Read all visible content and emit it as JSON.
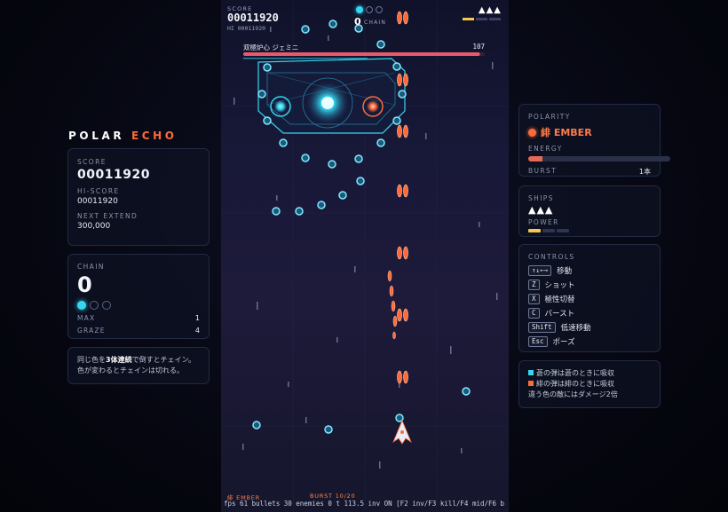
{
  "title": {
    "part1": "POLAR",
    "part2": "ECHO"
  },
  "left": {
    "score_label": "SCORE",
    "score": "00011920",
    "hiscore_label": "HI-SCORE",
    "hiscore": "00011920",
    "extend_label": "NEXT EXTEND",
    "extend": "300,000",
    "chain_label": "CHAIN",
    "chain": "0",
    "chain_dots": [
      true,
      false,
      false
    ],
    "max_label": "MAX",
    "max": "1",
    "graze_label": "GRAZE",
    "graze": "4",
    "hint_1a": "同じ色を",
    "hint_1b": "3体連続",
    "hint_1c": "で倒すとチェイン。",
    "hint_2": "色が変わるとチェインは切れる。"
  },
  "right": {
    "polarity_label": "POLARITY",
    "polarity_value": "緋 EMBER",
    "energy_label": "ENERGY",
    "energy_fraction": 0.1,
    "burst_label": "BURST",
    "burst_value": "1本",
    "ships_label": "SHIPS",
    "ships": "▲▲▲",
    "power_label": "POWER",
    "power_level": 1,
    "power_max": 3,
    "controls_label": "CONTROLS",
    "controls": [
      {
        "key": "↑↓←→",
        "action": "移動"
      },
      {
        "key": "Z",
        "action": "ショット"
      },
      {
        "key": "X",
        "action": "極性切替"
      },
      {
        "key": "C",
        "action": "バースト"
      },
      {
        "key": "Shift",
        "action": "低速移動"
      },
      {
        "key": "Esc",
        "action": "ポーズ"
      }
    ],
    "legend_1": "蒼の弾は蒼のときに吸収",
    "legend_2": "緋の弾は緋のときに吸収",
    "legend_3": "違う色の敵にはダメージ2倍",
    "color_azure": "#35d6f0",
    "color_ember": "#ff6a3a"
  },
  "hud": {
    "score_label": "SCORE",
    "score": "00011920",
    "hi": "HI 00011920",
    "chain": "0",
    "chain_label": "CHAIN",
    "ships": "▲▲▲",
    "boss_name": "双極炉心 ジェミニ",
    "boss_hp": "107",
    "boss_hp_fraction": 0.98,
    "polarity": "緋 EMBER",
    "burst": "BURST 10/20",
    "debug": "fps 61  bullets 30  enemies 0  t 113.5  inv ON  [F2 inv/F3 kill/F4 mid/F6 b"
  }
}
